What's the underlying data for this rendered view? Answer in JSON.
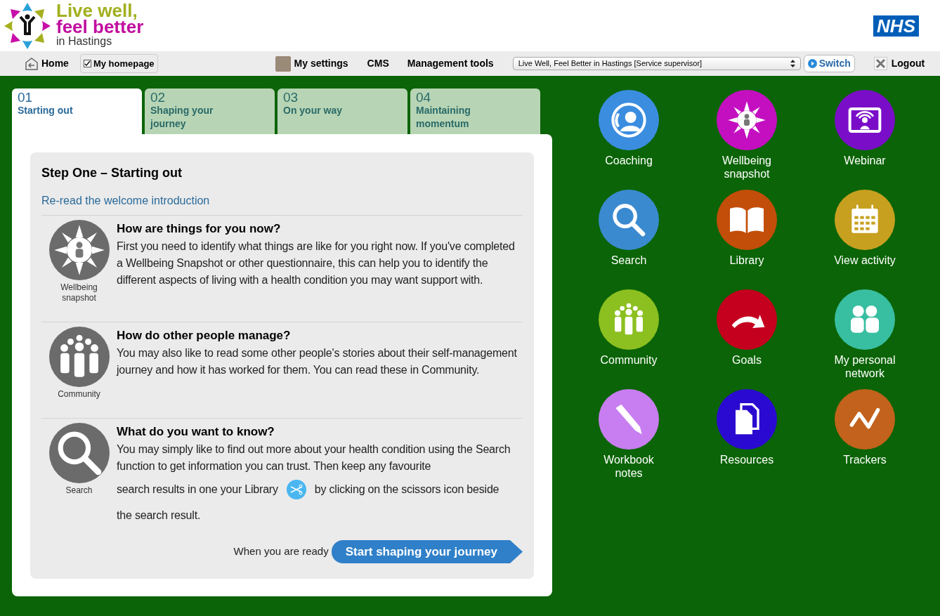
{
  "logo": {
    "line_1": "Live well,",
    "line_2": "feel better",
    "line_3": "in Hastings"
  },
  "nhs_logo": "NHS",
  "nav": {
    "home": "Home",
    "my_homepage": {
      "label": "My homepage",
      "checked": true
    },
    "my_settings": "My settings",
    "cms": "CMS",
    "management_tools": "Management tools",
    "role_select": {
      "value": "Live Well, Feel Better in Hastings [Service supervisor]"
    },
    "switch": "Switch",
    "logout": "Logout"
  },
  "tabs": [
    {
      "number": "01",
      "label": "Starting out",
      "selected": true
    },
    {
      "number": "02",
      "label": "Shaping your journey",
      "selected": false
    },
    {
      "number": "03",
      "label": "On your way",
      "selected": false
    },
    {
      "number": "04",
      "label": "Maintaining momentum",
      "selected": false
    }
  ],
  "step": {
    "title": "Step One – Starting out",
    "link": "Re-read the welcome introduction",
    "sections": [
      {
        "kind": "sun",
        "caption": "Wellbeing snapshot",
        "heading": "How are things for you now?",
        "body": "First you need to identify what things are like for you right now. If you've completed a Wellbeing Snapshot or other questionnaire, this can help you to identify the different aspects of living with a health condition you may want support with."
      },
      {
        "kind": "crowd",
        "caption": "Community",
        "heading": "How do other people manage?",
        "body": "You may also like to read some other people's stories about their self-management journey and how it has worked for them. You can read these in Community."
      },
      {
        "kind": "search",
        "caption": "Search",
        "heading": "What do you want to know?",
        "body": "You may simply like to find out more about your health condition using the Search function to get information you can trust. Then keep any favourite",
        "before_icon": "search results in one your Library",
        "after_icon": "by clicking on the scissors icon beside",
        "last_line": "the search result."
      }
    ],
    "ready_text": "When you are ready",
    "next_button": "Start shaping your journey"
  },
  "tiles": [
    {
      "kind": "coach",
      "label": "Coaching",
      "color": "#3b8de0"
    },
    {
      "kind": "sun",
      "label": "Wellbeing snapshot",
      "color": "#c40fc0"
    },
    {
      "kind": "screen",
      "label": "Webinar",
      "color": "#7a0ec8"
    },
    {
      "kind": "search",
      "label": "Search",
      "color": "#3a8ad0"
    },
    {
      "kind": "book",
      "label": "Library",
      "color": "#c24e0a"
    },
    {
      "kind": "calendar",
      "label": "View activity",
      "color": "#c8a020"
    },
    {
      "kind": "crowd",
      "label": "Community",
      "color": "#8cc020"
    },
    {
      "kind": "arrow",
      "label": "Goals",
      "color": "#c4001e"
    },
    {
      "kind": "pair",
      "label": "My personal network",
      "color": "#38bea0"
    },
    {
      "kind": "pencil",
      "label": "Workbook notes",
      "color": "#c87ef0"
    },
    {
      "kind": "docs",
      "label": "Resources",
      "color": "#2a0ad0"
    },
    {
      "kind": "zigzag",
      "label": "Trackers",
      "color": "#c2621c"
    }
  ]
}
